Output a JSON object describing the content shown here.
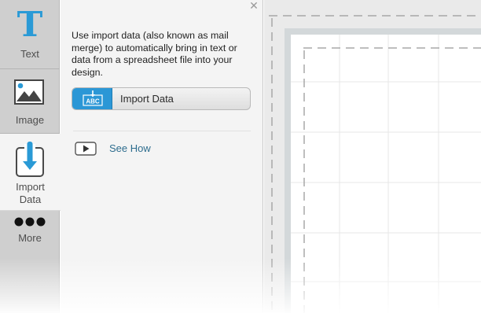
{
  "sidebar": {
    "tools": [
      {
        "label": "Text",
        "icon": "text-T-icon"
      },
      {
        "label": "Image",
        "icon": "image-icon"
      },
      {
        "label": "Import\nData",
        "icon": "import-data-icon",
        "active": true
      },
      {
        "label": "More",
        "icon": "more-dots-icon"
      }
    ]
  },
  "panel": {
    "close_icon": "close-icon",
    "description": "Use import data (also known as mail merge) to automatically bring in text or data from a spreadsheet file into your design.",
    "import_button": {
      "label": "Import Data",
      "icon_text": "ABC",
      "icon": "abc-import-icon"
    },
    "see_how": {
      "label": "See How",
      "icon": "play-icon"
    }
  },
  "colors": {
    "accent": "#2a9ad6",
    "link": "#2e6d8e",
    "rail": "#cfcfcf",
    "panel": "#f4f4f4"
  }
}
